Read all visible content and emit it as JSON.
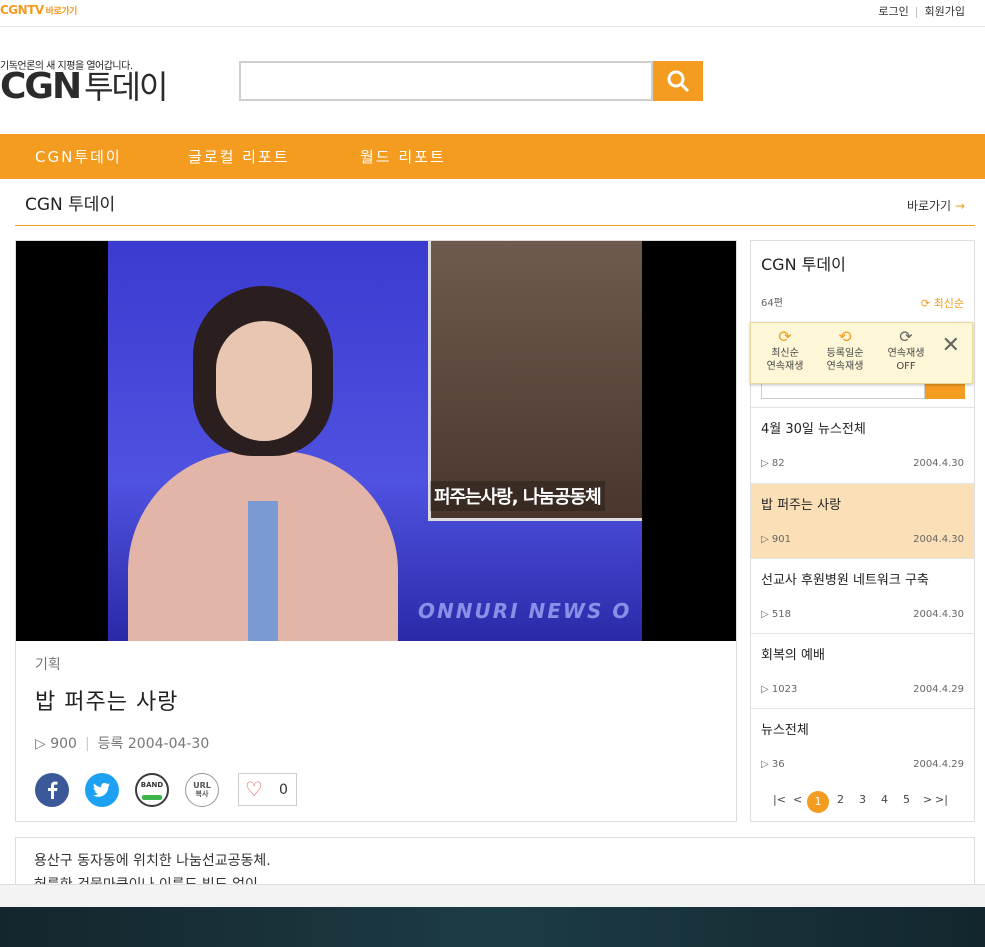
{
  "topbar": {
    "brand": "CGNTV",
    "brand_sub": "바로가기",
    "login": "로그인",
    "join": "회원가입"
  },
  "header": {
    "tagline": "기독언론의 새 지평을 열어갑니다.",
    "logo_en": "CGN",
    "logo_ko": "투데이",
    "search_value": ""
  },
  "nav": {
    "items": [
      "CGN투데이",
      "글로컬 리포트",
      "월드 리포트"
    ]
  },
  "section": {
    "title": "CGN 투데이",
    "shortcut": "바로가기",
    "arrow": "→"
  },
  "video": {
    "caption": "퍼주는사랑, 나눔공동체",
    "news_text": "ONNURI NEWS O"
  },
  "article": {
    "category": "기획",
    "title": "밥 퍼주는 사랑",
    "views": "▷ 900",
    "date_label": "등록 2004-04-30",
    "likes": "0",
    "share": [
      "facebook-icon",
      "twitter-icon",
      "band-icon",
      "url-copy-icon"
    ],
    "band_label": "BAND",
    "url_label_1": "URL",
    "url_label_2": "복사"
  },
  "sidebar": {
    "title": "CGN 투데이",
    "count": "64편",
    "sort_label": "최신순",
    "popup": {
      "options": [
        {
          "line1": "최신순",
          "line2": "연속재생"
        },
        {
          "line1": "등록일순",
          "line2": "연속재생"
        },
        {
          "line1": "연속재생",
          "line2": "OFF"
        }
      ]
    },
    "items": [
      {
        "title": "4월 30일 뉴스전체",
        "views": "▷ 82",
        "date": "2004.4.30"
      },
      {
        "title": "밥 퍼주는 사랑",
        "views": "▷ 901",
        "date": "2004.4.30"
      },
      {
        "title": "선교사 후원병원 네트워크 구축",
        "views": "▷ 518",
        "date": "2004.4.30"
      },
      {
        "title": "회복의 예배",
        "views": "▷ 1023",
        "date": "2004.4.29"
      },
      {
        "title": "뉴스전체",
        "views": "▷ 36",
        "date": "2004.4.29"
      }
    ],
    "pager": {
      "pages": [
        "1",
        "2",
        "3",
        "4",
        "5"
      ],
      "current": "1"
    }
  },
  "description": {
    "line1": "용산구 동자동에 위치한 나눔선교공동체.",
    "line2": "허름한 건물마큼이나 이름도 빛도 없이"
  },
  "colors": {
    "accent": "#f39c1f",
    "active_row": "#fbe0b7"
  }
}
